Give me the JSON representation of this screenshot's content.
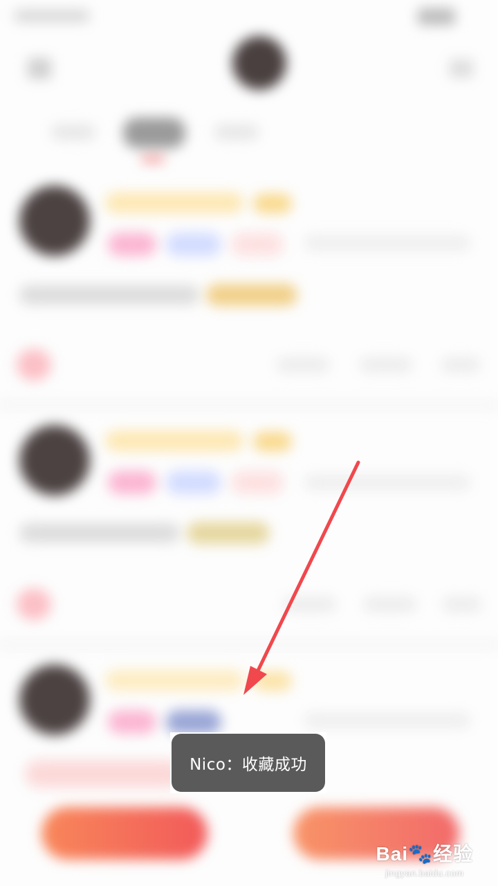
{
  "toast": {
    "text": "Nico：收藏成功"
  },
  "watermark": {
    "brand": "Bai",
    "brand_suffix": "经验",
    "domain": "jingyan.baidu.com"
  },
  "colors": {
    "background": "#fdfdfd",
    "toast_bg": "#5a5a5a",
    "accent_gradient_start": "#f8875a",
    "accent_gradient_end": "#f25a5a",
    "annotation_arrow": "#f0484d"
  },
  "icons": [
    "back-icon",
    "more-icon",
    "paw-icon"
  ]
}
